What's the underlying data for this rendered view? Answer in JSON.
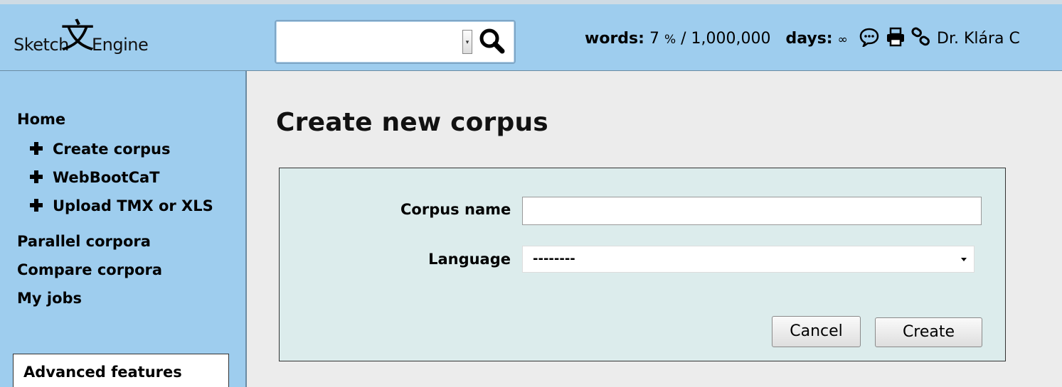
{
  "header": {
    "logo": {
      "left": "Sketch",
      "glyph": "文",
      "right": "Engine"
    },
    "search": {
      "value": "",
      "placeholder": ""
    },
    "stats": {
      "words_label": "words:",
      "words_value": "7",
      "words_pct": "%",
      "words_rest": "/ 1,000,000",
      "days_label": "days:",
      "days_value": "∞"
    },
    "icons": [
      "chat-bubble-icon",
      "print-icon",
      "link-icon"
    ],
    "user_name": "Dr. Klára C"
  },
  "sidebar": {
    "home": "Home",
    "sub_items": [
      {
        "label": "Create corpus"
      },
      {
        "label": "WebBootCaT"
      },
      {
        "label": "Upload TMX or XLS"
      }
    ],
    "items": [
      {
        "label": "Parallel corpora"
      },
      {
        "label": "Compare corpora"
      },
      {
        "label": "My jobs"
      }
    ],
    "advanced": "Advanced features"
  },
  "main": {
    "title": "Create new corpus",
    "form": {
      "corpus_name_label": "Corpus name",
      "corpus_name_value": "",
      "language_label": "Language",
      "language_value": "--------",
      "cancel_label": "Cancel",
      "create_label": "Create"
    }
  },
  "colors": {
    "header_bg": "#9ecdee",
    "main_bg": "#ececec",
    "panel_bg": "#dcecec"
  }
}
